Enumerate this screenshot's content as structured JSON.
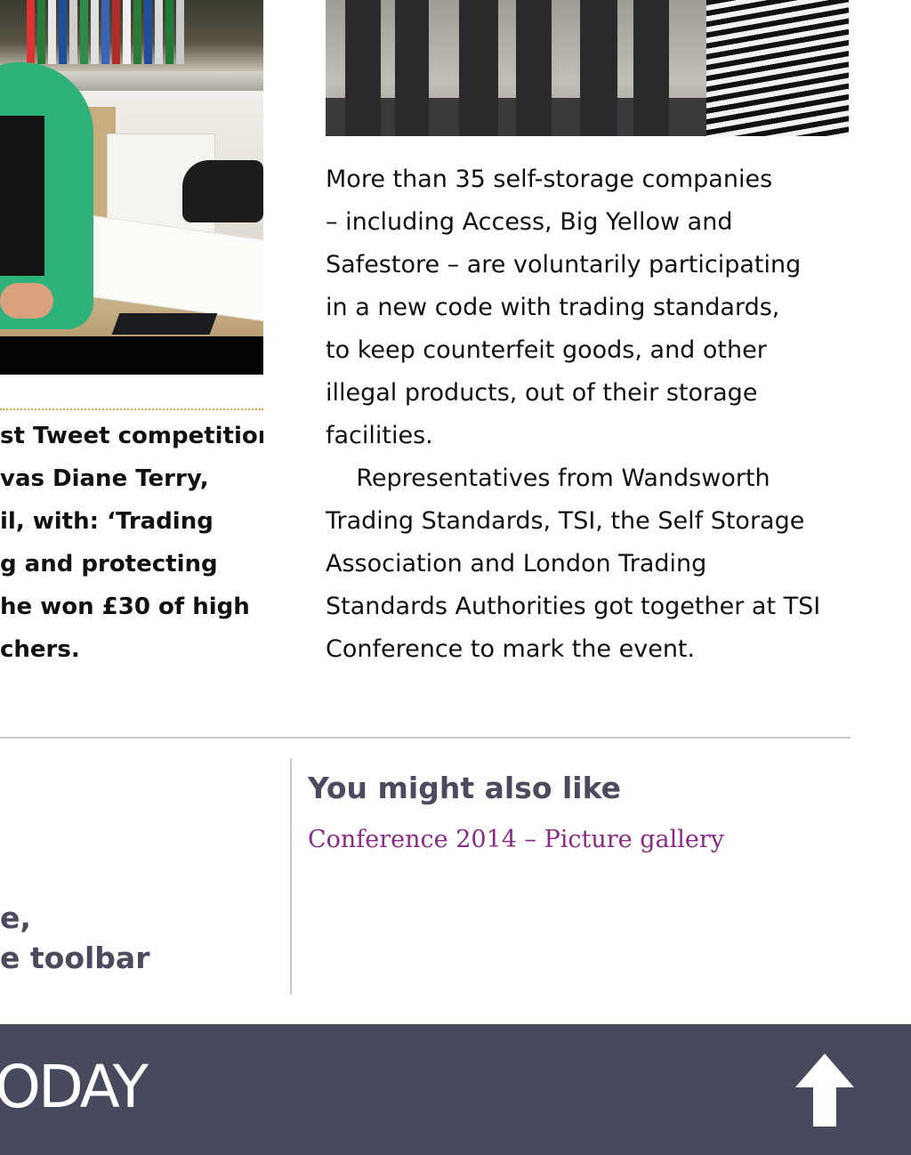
{
  "article": {
    "caption_lines": [
      "st Tweet competition",
      "vas Diane Terry,",
      "il, with: ‘Trading",
      "g and protecting",
      "he won £30 of high",
      "chers."
    ],
    "body_lines": [
      "More than 35 self-storage companies",
      "– including Access, Big Yellow and",
      "Safestore – are voluntarily participating",
      "in a new code with trading standards,",
      "to keep counterfeit goods, and other",
      "illegal products, out of their storage",
      "facilities.",
      "    Representatives from Wandsworth",
      "Trading Standards, TSI, the Self Storage",
      "Association and London Trading",
      "Standards Authorities got together at TSI",
      "Conference to mark the event."
    ]
  },
  "related": {
    "title": "You might also like",
    "link": "Conference 2014 – Picture gallery"
  },
  "left_panel": {
    "line1": "e,",
    "line2": "e toolbar"
  },
  "footer": {
    "brand": "ODAY",
    "up_icon": "arrow-up-icon",
    "color": "#474a5d"
  },
  "colors": {
    "accent_dots": "#e8a33d",
    "heading": "#4b4a5e",
    "link": "#8b2a86"
  }
}
